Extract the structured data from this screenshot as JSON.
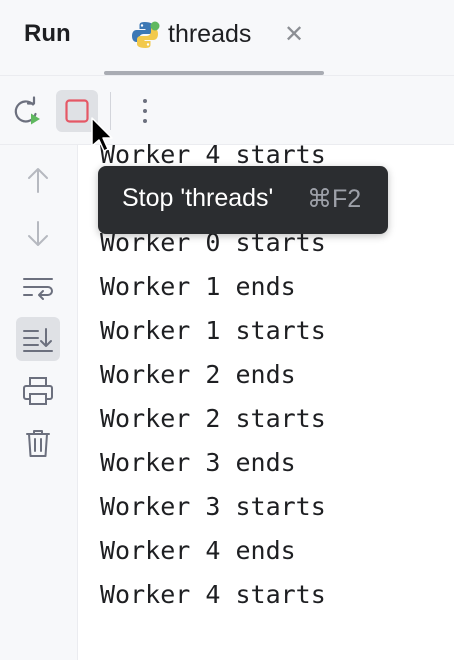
{
  "header": {
    "title": "Run",
    "tab": {
      "label": "threads",
      "icon": "python-icon",
      "close_icon": "close-icon"
    }
  },
  "toolbar": {
    "buttons": [
      {
        "icon": "rerun-icon"
      },
      {
        "icon": "stop-icon",
        "color": "#e06c75",
        "hovered": true
      },
      {
        "icon": "more-vertical-icon"
      }
    ]
  },
  "gutter": {
    "buttons": [
      {
        "icon": "arrow-up-icon",
        "enabled": false
      },
      {
        "icon": "arrow-down-icon",
        "enabled": false
      },
      {
        "icon": "soft-wrap-icon"
      },
      {
        "icon": "scroll-to-end-icon",
        "active": true
      },
      {
        "icon": "print-icon"
      },
      {
        "icon": "trash-icon"
      }
    ]
  },
  "console": {
    "lines": [
      "Worker 4 starts",
      "",
      "Worker 0 starts",
      "Worker 1 ends",
      "Worker 1 starts",
      "Worker 2 ends",
      "Worker 2 starts",
      "Worker 3 ends",
      "Worker 3 starts",
      "Worker 4 ends",
      "Worker 4 starts"
    ]
  },
  "tooltip": {
    "text": "Stop 'threads'",
    "shortcut": "⌘F2"
  },
  "colors": {
    "accent_stop": "#e06c75",
    "background": "#ffffff",
    "panel": "#f7f8fa",
    "tooltip_bg": "#2b2d30"
  }
}
